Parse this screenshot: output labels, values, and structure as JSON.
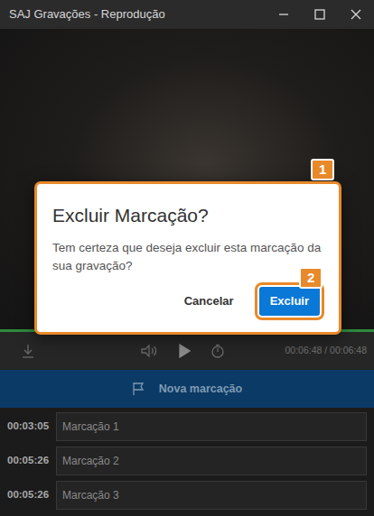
{
  "window": {
    "title": "SAJ Gravações - Reprodução"
  },
  "player": {
    "progress": {
      "level": 1.0,
      "color": "#2e8b3e"
    },
    "time": "00:06:48 / 00:06:48"
  },
  "new_mark_button": {
    "label": "Nova marcação"
  },
  "marks": [
    {
      "time": "00:03:05",
      "label": "Marcação 1"
    },
    {
      "time": "00:05:26",
      "label": "Marcação 2"
    },
    {
      "time": "00:05:26",
      "label": "Marcação 3"
    }
  ],
  "dialog": {
    "title": "Excluir Marcação?",
    "message": "Tem certeza que deseja excluir esta marcação da sua gravação?",
    "buttons": [
      {
        "label": "Cancelar",
        "primary": false
      },
      {
        "label": "Excluir",
        "primary": true
      }
    ]
  },
  "annotations": [
    "1",
    "2"
  ]
}
